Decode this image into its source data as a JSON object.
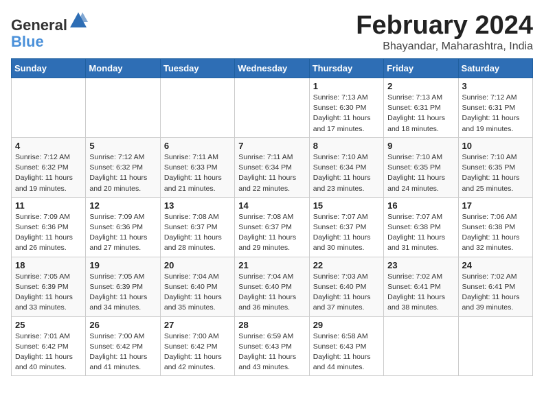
{
  "header": {
    "logo_line1": "General",
    "logo_line2": "Blue",
    "title": "February 2024",
    "subtitle": "Bhayandar, Maharashtra, India"
  },
  "weekdays": [
    "Sunday",
    "Monday",
    "Tuesday",
    "Wednesday",
    "Thursday",
    "Friday",
    "Saturday"
  ],
  "weeks": [
    [
      {
        "day": "",
        "info": ""
      },
      {
        "day": "",
        "info": ""
      },
      {
        "day": "",
        "info": ""
      },
      {
        "day": "",
        "info": ""
      },
      {
        "day": "1",
        "info": "Sunrise: 7:13 AM\nSunset: 6:30 PM\nDaylight: 11 hours and 17 minutes."
      },
      {
        "day": "2",
        "info": "Sunrise: 7:13 AM\nSunset: 6:31 PM\nDaylight: 11 hours and 18 minutes."
      },
      {
        "day": "3",
        "info": "Sunrise: 7:12 AM\nSunset: 6:31 PM\nDaylight: 11 hours and 19 minutes."
      }
    ],
    [
      {
        "day": "4",
        "info": "Sunrise: 7:12 AM\nSunset: 6:32 PM\nDaylight: 11 hours and 19 minutes."
      },
      {
        "day": "5",
        "info": "Sunrise: 7:12 AM\nSunset: 6:32 PM\nDaylight: 11 hours and 20 minutes."
      },
      {
        "day": "6",
        "info": "Sunrise: 7:11 AM\nSunset: 6:33 PM\nDaylight: 11 hours and 21 minutes."
      },
      {
        "day": "7",
        "info": "Sunrise: 7:11 AM\nSunset: 6:34 PM\nDaylight: 11 hours and 22 minutes."
      },
      {
        "day": "8",
        "info": "Sunrise: 7:10 AM\nSunset: 6:34 PM\nDaylight: 11 hours and 23 minutes."
      },
      {
        "day": "9",
        "info": "Sunrise: 7:10 AM\nSunset: 6:35 PM\nDaylight: 11 hours and 24 minutes."
      },
      {
        "day": "10",
        "info": "Sunrise: 7:10 AM\nSunset: 6:35 PM\nDaylight: 11 hours and 25 minutes."
      }
    ],
    [
      {
        "day": "11",
        "info": "Sunrise: 7:09 AM\nSunset: 6:36 PM\nDaylight: 11 hours and 26 minutes."
      },
      {
        "day": "12",
        "info": "Sunrise: 7:09 AM\nSunset: 6:36 PM\nDaylight: 11 hours and 27 minutes."
      },
      {
        "day": "13",
        "info": "Sunrise: 7:08 AM\nSunset: 6:37 PM\nDaylight: 11 hours and 28 minutes."
      },
      {
        "day": "14",
        "info": "Sunrise: 7:08 AM\nSunset: 6:37 PM\nDaylight: 11 hours and 29 minutes."
      },
      {
        "day": "15",
        "info": "Sunrise: 7:07 AM\nSunset: 6:37 PM\nDaylight: 11 hours and 30 minutes."
      },
      {
        "day": "16",
        "info": "Sunrise: 7:07 AM\nSunset: 6:38 PM\nDaylight: 11 hours and 31 minutes."
      },
      {
        "day": "17",
        "info": "Sunrise: 7:06 AM\nSunset: 6:38 PM\nDaylight: 11 hours and 32 minutes."
      }
    ],
    [
      {
        "day": "18",
        "info": "Sunrise: 7:05 AM\nSunset: 6:39 PM\nDaylight: 11 hours and 33 minutes."
      },
      {
        "day": "19",
        "info": "Sunrise: 7:05 AM\nSunset: 6:39 PM\nDaylight: 11 hours and 34 minutes."
      },
      {
        "day": "20",
        "info": "Sunrise: 7:04 AM\nSunset: 6:40 PM\nDaylight: 11 hours and 35 minutes."
      },
      {
        "day": "21",
        "info": "Sunrise: 7:04 AM\nSunset: 6:40 PM\nDaylight: 11 hours and 36 minutes."
      },
      {
        "day": "22",
        "info": "Sunrise: 7:03 AM\nSunset: 6:40 PM\nDaylight: 11 hours and 37 minutes."
      },
      {
        "day": "23",
        "info": "Sunrise: 7:02 AM\nSunset: 6:41 PM\nDaylight: 11 hours and 38 minutes."
      },
      {
        "day": "24",
        "info": "Sunrise: 7:02 AM\nSunset: 6:41 PM\nDaylight: 11 hours and 39 minutes."
      }
    ],
    [
      {
        "day": "25",
        "info": "Sunrise: 7:01 AM\nSunset: 6:42 PM\nDaylight: 11 hours and 40 minutes."
      },
      {
        "day": "26",
        "info": "Sunrise: 7:00 AM\nSunset: 6:42 PM\nDaylight: 11 hours and 41 minutes."
      },
      {
        "day": "27",
        "info": "Sunrise: 7:00 AM\nSunset: 6:42 PM\nDaylight: 11 hours and 42 minutes."
      },
      {
        "day": "28",
        "info": "Sunrise: 6:59 AM\nSunset: 6:43 PM\nDaylight: 11 hours and 43 minutes."
      },
      {
        "day": "29",
        "info": "Sunrise: 6:58 AM\nSunset: 6:43 PM\nDaylight: 11 hours and 44 minutes."
      },
      {
        "day": "",
        "info": ""
      },
      {
        "day": "",
        "info": ""
      }
    ]
  ]
}
